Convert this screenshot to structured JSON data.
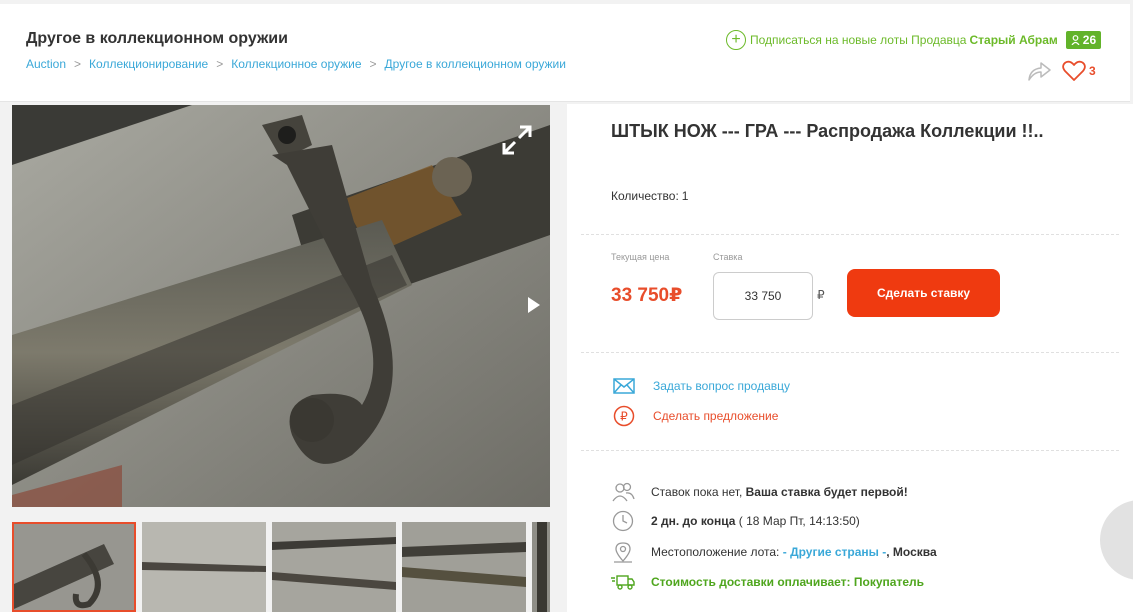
{
  "header": {
    "category_title": "Другое в коллекционном оружии",
    "breadcrumbs": [
      {
        "label": "Auction"
      },
      {
        "label": "Коллекционирование"
      },
      {
        "label": "Коллекционное оружие"
      },
      {
        "label": "Другое в коллекционном оружии"
      }
    ],
    "breadcrumb_separator": ">",
    "subscribe_text": "Подписаться на новые лоты Продавца",
    "seller_name": "Старый Абрам",
    "seller_rating": "26",
    "favorites_count": "3"
  },
  "lot": {
    "title": "ШТЫК НОЖ --- ГРА --- Распродажа Коллекции !!..",
    "quantity_label": "Количество:",
    "quantity_value": "1"
  },
  "bid": {
    "current_price_label": "Текущая цена",
    "current_price": "33 750₽",
    "bid_label": "Ставка",
    "bid_value": "33 750",
    "currency_symbol": "₽",
    "button_label": "Сделать ставку"
  },
  "actions": {
    "ask_seller": "Задать вопрос продавцу",
    "make_offer": "Сделать предложение"
  },
  "meta": {
    "bids_text": "Ставок пока нет,",
    "bids_bold": "Ваша ставка будет первой!",
    "time_left_bold": "2 дн. до конца",
    "end_date": "( 18 Мар Пт, 14:13:50)",
    "location_label": "Местоположение лота:",
    "location_country": "- Другие страны -",
    "location_city": ", Москва",
    "shipping_text": "Стоимость доставки оплачивает: Покупатель"
  },
  "colors": {
    "accent_red": "#ef3a10",
    "link_blue": "#3aa8d8",
    "green": "#6cba29"
  },
  "icons": [
    "plus-circle-icon",
    "user-icon",
    "share-icon",
    "heart-icon",
    "expand-icon",
    "chevron-right-icon",
    "envelope-icon",
    "ruble-circle-icon",
    "users-icon",
    "clock-icon",
    "location-pin-icon",
    "truck-icon"
  ]
}
